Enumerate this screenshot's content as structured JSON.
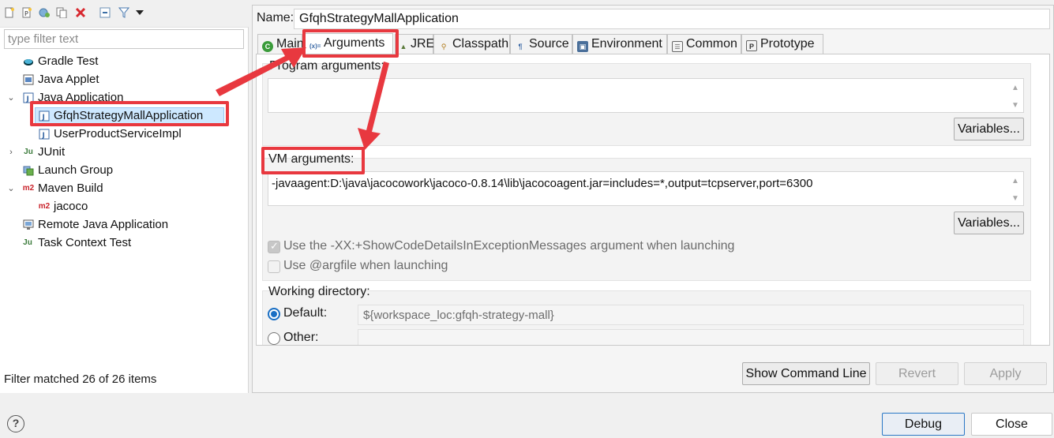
{
  "left": {
    "toolbar": {
      "icons": [
        "new-configuration-icon",
        "new-prototype-icon",
        "export-icon",
        "duplicate-icon",
        "delete-icon",
        "collapse-all-icon",
        "filter-icon",
        "view-menu-icon"
      ]
    },
    "filter_placeholder": "type filter text",
    "tree": [
      {
        "label": "Gradle Test",
        "icon": "gradle-icon"
      },
      {
        "label": "Java Applet",
        "icon": "java-applet-icon"
      },
      {
        "label": "Java Application",
        "icon": "java-application-icon",
        "expanded": true
      },
      {
        "label": "GfqhStrategyMallApplication",
        "icon": "java-application-icon",
        "selected": true
      },
      {
        "label": "UserProductServiceImpl",
        "icon": "java-application-icon"
      },
      {
        "label": "JUnit",
        "icon": "junit-icon",
        "expanded": false
      },
      {
        "label": "Launch Group",
        "icon": "launch-group-icon"
      },
      {
        "label": "Maven Build",
        "icon": "maven-icon",
        "expanded": true
      },
      {
        "label": "jacoco",
        "icon": "maven-icon"
      },
      {
        "label": "Remote Java Application",
        "icon": "remote-java-icon"
      },
      {
        "label": "Task Context Test",
        "icon": "task-context-icon"
      }
    ],
    "status": "Filter matched 26 of 26 items"
  },
  "config": {
    "name_label": "Name:",
    "name_value": "GfqhStrategyMallApplication",
    "tabs": [
      {
        "label": "Main",
        "icon": "main-icon"
      },
      {
        "label": "Arguments",
        "icon": "arguments-icon",
        "active": true
      },
      {
        "label": "JRE",
        "icon": "jre-icon"
      },
      {
        "label": "Classpath",
        "icon": "classpath-icon"
      },
      {
        "label": "Source",
        "icon": "source-icon"
      },
      {
        "label": "Environment",
        "icon": "environment-icon"
      },
      {
        "label": "Common",
        "icon": "common-icon"
      },
      {
        "label": "Prototype",
        "icon": "prototype-icon"
      }
    ],
    "program_args_label": "Program arguments:",
    "program_args_value": "",
    "variables_label": "Variables...",
    "vm_args_label": "VM arguments:",
    "vm_args_value": "-javaagent:D:\\java\\jacocowork\\jacoco-0.8.14\\lib\\jacocoagent.jar=includes=*,output=tcpserver,port=6300",
    "show_code_details_label": "Use the -XX:+ShowCodeDetailsInExceptionMessages argument when launching",
    "show_code_details_checked": true,
    "argfile_label": "Use @argfile when launching",
    "argfile_checked": false,
    "working_dir_label": "Working directory:",
    "default_label": "Default:",
    "default_value": "${workspace_loc:gfqh-strategy-mall}",
    "other_label": "Other:",
    "working_dir_selected": "Default"
  },
  "buttons": {
    "show_command_line": "Show Command Line",
    "revert": "Revert",
    "apply": "Apply",
    "debug": "Debug",
    "close": "Close"
  },
  "colors": {
    "annotation": "#e8383f",
    "accent": "#1a6fc4",
    "selection": "#cde8ff"
  }
}
